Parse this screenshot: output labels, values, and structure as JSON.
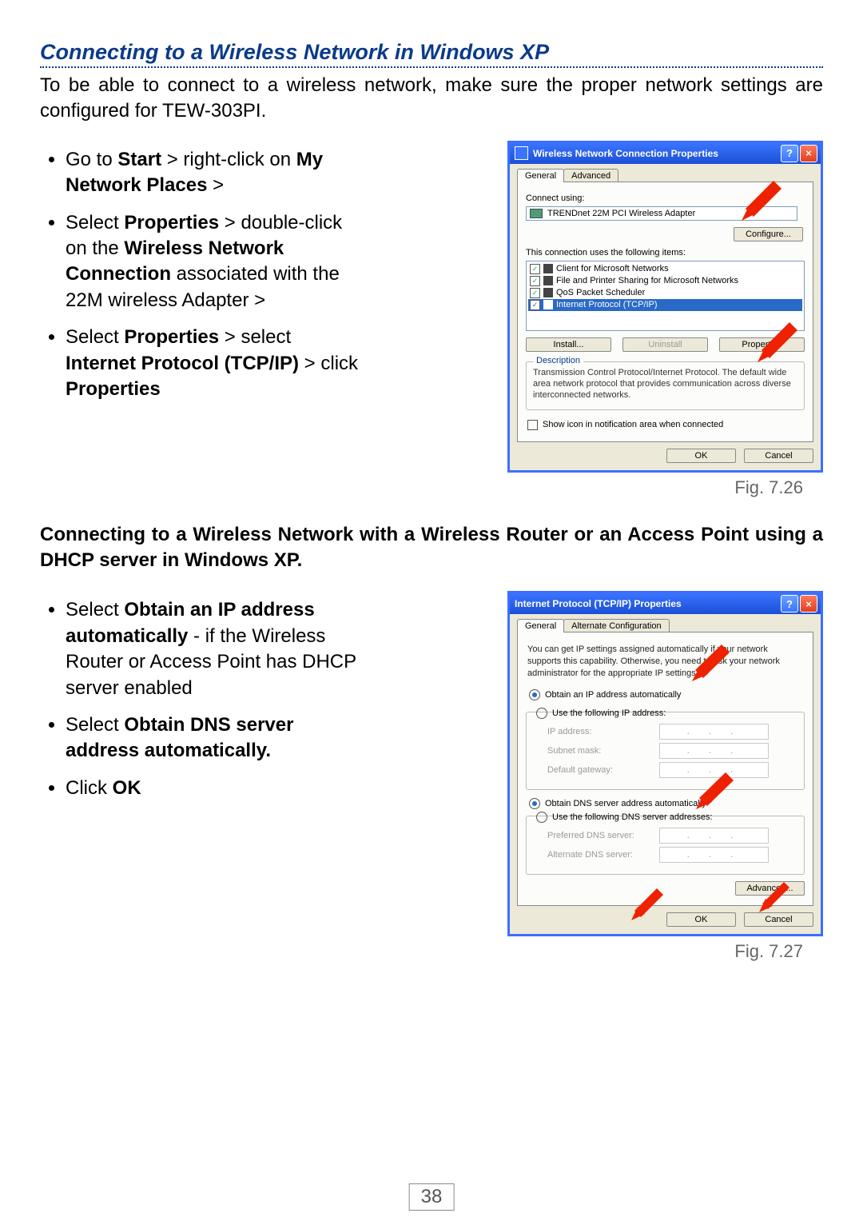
{
  "page_number": "38",
  "section_title": "Connecting to a Wireless Network in Windows XP",
  "intro": "To be able to connect to a wireless network, make sure the proper network settings are configured for TEW-303PI.",
  "bullets1": [
    {
      "pre": "Go to ",
      "b1": "Start",
      "mid": " > right-click on ",
      "b2": "My Network Places",
      "post": " >"
    },
    {
      "pre": "Select ",
      "b1": "Properties",
      "mid": " > double-click on the ",
      "b2": "Wireless Network Connection",
      "post": " associated with the 22M wireless Adapter >"
    },
    {
      "pre": "Select ",
      "b1": "Properties",
      "mid": " > select ",
      "b2": "Internet Protocol (TCP/IP)",
      "post": " > click ",
      "b3": "Properties"
    }
  ],
  "fig1_caption": "Fig. 7.26",
  "subhead": "Connecting to a Wireless Network with a Wireless Router or an Access Point using a DHCP server in Windows XP.",
  "bullets2": [
    {
      "pre": "Select ",
      "b1": "Obtain an IP address automatically",
      "post": " - if the Wireless Router or Access Point has DHCP server enabled"
    },
    {
      "pre": "Select ",
      "b1": "Obtain DNS server address automatically.",
      "post": ""
    },
    {
      "pre": " Click ",
      "b1": "OK",
      "post": ""
    }
  ],
  "fig2_caption": "Fig. 7.27",
  "dlg1": {
    "title": "Wireless Network Connection Properties",
    "tabs": [
      "General",
      "Advanced"
    ],
    "connect_label": "Connect using:",
    "adapter": "TRENDnet 22M PCI Wireless Adapter",
    "configure": "Configure...",
    "uses_label": "This connection uses the following items:",
    "items": [
      "Client for Microsoft Networks",
      "File and Printer Sharing for Microsoft Networks",
      "QoS Packet Scheduler",
      "Internet Protocol (TCP/IP)"
    ],
    "install": "Install...",
    "uninstall": "Uninstall",
    "properties": "Properties",
    "desc_label": "Description",
    "desc": "Transmission Control Protocol/Internet Protocol. The default wide area network protocol that provides communication across diverse interconnected networks.",
    "show_icon": "Show icon in notification area when connected",
    "ok": "OK",
    "cancel": "Cancel"
  },
  "dlg2": {
    "title": "Internet Protocol (TCP/IP) Properties",
    "tabs": [
      "General",
      "Alternate Configuration"
    ],
    "info": "You can get IP settings assigned automatically if your network supports this capability. Otherwise, you need to ask your network administrator for the appropriate IP settings.",
    "r1": "Obtain an IP address automatically",
    "r2": "Use the following IP address:",
    "ip": "IP address:",
    "sm": "Subnet mask:",
    "gw": "Default gateway:",
    "r3": "Obtain DNS server address automatically",
    "r4": "Use the following DNS server addresses:",
    "pdns": "Preferred DNS server:",
    "adns": "Alternate DNS server:",
    "adv": "Advanced...",
    "ok": "OK",
    "cancel": "Cancel"
  }
}
